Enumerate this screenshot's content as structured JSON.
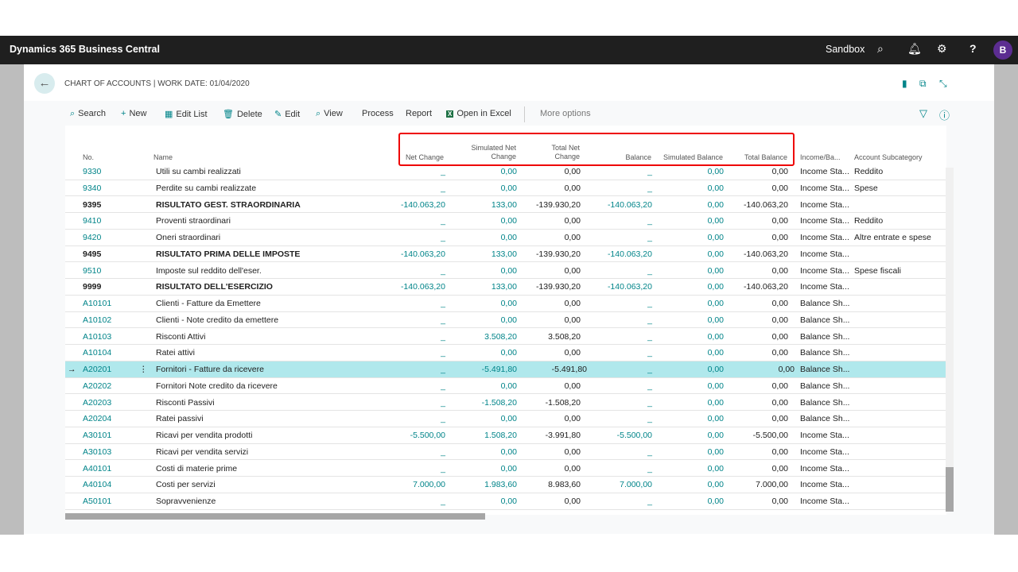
{
  "header": {
    "app_title": "Dynamics 365 Business Central",
    "environment": "Sandbox",
    "avatar_initial": "B",
    "icons": [
      "search-icon",
      "bell-icon",
      "gear-icon",
      "help-icon"
    ]
  },
  "page": {
    "title": "CHART OF ACCOUNTS | WORK DATE: 01/04/2020"
  },
  "actions": [
    {
      "label": "Search",
      "icon": "⌕"
    },
    {
      "label": "New",
      "icon": "+"
    },
    {
      "label": "Edit List",
      "icon": "▦"
    },
    {
      "label": "Delete",
      "icon": "🗑"
    },
    {
      "label": "Edit",
      "icon": "✎"
    },
    {
      "label": "View",
      "icon": "⌕"
    },
    {
      "label": "Process",
      "icon": ""
    },
    {
      "label": "Report",
      "icon": ""
    },
    {
      "label": "Open in Excel",
      "icon": "X"
    },
    {
      "label": "More options",
      "icon": ""
    }
  ],
  "columns": {
    "no": "No.",
    "name": "Name",
    "net_change": "Net Change",
    "sim_net_1": "Simulated Net",
    "sim_net_2": "Change",
    "total_net_1": "Total Net",
    "total_net_2": "Change",
    "balance": "Balance",
    "sim_balance": "Simulated Balance",
    "total_balance": "Total Balance",
    "income_balance": "Income/Ba...",
    "subcategory": "Account Subcategory"
  },
  "rows": [
    {
      "no": "9330",
      "name": "Utili su cambi realizzati",
      "nc": "_",
      "snc": "0,00",
      "tnc": "0,00",
      "bal": "_",
      "sb": "0,00",
      "tb": "0,00",
      "ib": "Income Sta...",
      "sub": "Reddito",
      "bold": false
    },
    {
      "no": "9340",
      "name": "Perdite su cambi realizzate",
      "nc": "_",
      "snc": "0,00",
      "tnc": "0,00",
      "bal": "_",
      "sb": "0,00",
      "tb": "0,00",
      "ib": "Income Sta...",
      "sub": "Spese",
      "bold": false
    },
    {
      "no": "9395",
      "name": "RISULTATO GEST. STRAORDINARIA",
      "nc": "-140.063,20",
      "snc": "133,00",
      "tnc": "-139.930,20",
      "bal": "-140.063,20",
      "sb": "0,00",
      "tb": "-140.063,20",
      "ib": "Income Sta...",
      "sub": "",
      "bold": true
    },
    {
      "no": "9410",
      "name": "Proventi straordinari",
      "nc": "_",
      "snc": "0,00",
      "tnc": "0,00",
      "bal": "_",
      "sb": "0,00",
      "tb": "0,00",
      "ib": "Income Sta...",
      "sub": "Reddito",
      "bold": false
    },
    {
      "no": "9420",
      "name": "Oneri straordinari",
      "nc": "_",
      "snc": "0,00",
      "tnc": "0,00",
      "bal": "_",
      "sb": "0,00",
      "tb": "0,00",
      "ib": "Income Sta...",
      "sub": "Altre entrate e spese",
      "bold": false
    },
    {
      "no": "9495",
      "name": "RISULTATO PRIMA DELLE IMPOSTE",
      "nc": "-140.063,20",
      "snc": "133,00",
      "tnc": "-139.930,20",
      "bal": "-140.063,20",
      "sb": "0,00",
      "tb": "-140.063,20",
      "ib": "Income Sta...",
      "sub": "",
      "bold": true
    },
    {
      "no": "9510",
      "name": "Imposte sul reddito dell'eser.",
      "nc": "_",
      "snc": "0,00",
      "tnc": "0,00",
      "bal": "_",
      "sb": "0,00",
      "tb": "0,00",
      "ib": "Income Sta...",
      "sub": "Spese fiscali",
      "bold": false
    },
    {
      "no": "9999",
      "name": "RISULTATO DELL'ESERCIZIO",
      "nc": "-140.063,20",
      "snc": "133,00",
      "tnc": "-139.930,20",
      "bal": "-140.063,20",
      "sb": "0,00",
      "tb": "-140.063,20",
      "ib": "Income Sta...",
      "sub": "",
      "bold": true
    },
    {
      "no": "A10101",
      "name": "Clienti - Fatture da Emettere",
      "nc": "_",
      "snc": "0,00",
      "tnc": "0,00",
      "bal": "_",
      "sb": "0,00",
      "tb": "0,00",
      "ib": "Balance Sh...",
      "sub": "",
      "bold": false
    },
    {
      "no": "A10102",
      "name": "Clienti - Note credito da emettere",
      "nc": "_",
      "snc": "0,00",
      "tnc": "0,00",
      "bal": "_",
      "sb": "0,00",
      "tb": "0,00",
      "ib": "Balance Sh...",
      "sub": "",
      "bold": false
    },
    {
      "no": "A10103",
      "name": "Risconti Attivi",
      "nc": "_",
      "snc": "3.508,20",
      "tnc": "3.508,20",
      "bal": "_",
      "sb": "0,00",
      "tb": "0,00",
      "ib": "Balance Sh...",
      "sub": "",
      "bold": false
    },
    {
      "no": "A10104",
      "name": "Ratei attivi",
      "nc": "_",
      "snc": "0,00",
      "tnc": "0,00",
      "bal": "_",
      "sb": "0,00",
      "tb": "0,00",
      "ib": "Balance Sh...",
      "sub": "",
      "bold": false
    },
    {
      "no": "A20201",
      "name": "Fornitori - Fatture da ricevere",
      "nc": "_",
      "snc": "-5.491,80",
      "tnc": "-5.491,80",
      "bal": "_",
      "sb": "0,00",
      "tb": "0,00",
      "ib": "Balance Sh...",
      "sub": "",
      "bold": false,
      "selected": true
    },
    {
      "no": "A20202",
      "name": "Fornitori Note credito da ricevere",
      "nc": "_",
      "snc": "0,00",
      "tnc": "0,00",
      "bal": "_",
      "sb": "0,00",
      "tb": "0,00",
      "ib": "Balance Sh...",
      "sub": "",
      "bold": false
    },
    {
      "no": "A20203",
      "name": "Risconti Passivi",
      "nc": "_",
      "snc": "-1.508,20",
      "tnc": "-1.508,20",
      "bal": "_",
      "sb": "0,00",
      "tb": "0,00",
      "ib": "Balance Sh...",
      "sub": "",
      "bold": false
    },
    {
      "no": "A20204",
      "name": "Ratei passivi",
      "nc": "_",
      "snc": "0,00",
      "tnc": "0,00",
      "bal": "_",
      "sb": "0,00",
      "tb": "0,00",
      "ib": "Balance Sh...",
      "sub": "",
      "bold": false
    },
    {
      "no": "A30101",
      "name": "Ricavi per vendita prodotti",
      "nc": "-5.500,00",
      "snc": "1.508,20",
      "tnc": "-3.991,80",
      "bal": "-5.500,00",
      "sb": "0,00",
      "tb": "-5.500,00",
      "ib": "Income Sta...",
      "sub": "",
      "bold": false
    },
    {
      "no": "A30103",
      "name": "Ricavi per vendita servizi",
      "nc": "_",
      "snc": "0,00",
      "tnc": "0,00",
      "bal": "_",
      "sb": "0,00",
      "tb": "0,00",
      "ib": "Income Sta...",
      "sub": "",
      "bold": false
    },
    {
      "no": "A40101",
      "name": "Costi di materie prime",
      "nc": "_",
      "snc": "0,00",
      "tnc": "0,00",
      "bal": "_",
      "sb": "0,00",
      "tb": "0,00",
      "ib": "Income Sta...",
      "sub": "",
      "bold": false
    },
    {
      "no": "A40104",
      "name": "Costi per servizi",
      "nc": "7.000,00",
      "snc": "1.983,60",
      "tnc": "8.983,60",
      "bal": "7.000,00",
      "sb": "0,00",
      "tb": "7.000,00",
      "ib": "Income Sta...",
      "sub": "",
      "bold": false
    },
    {
      "no": "A50101",
      "name": "Sopravvenienze",
      "nc": "_",
      "snc": "0,00",
      "tnc": "0,00",
      "bal": "_",
      "sb": "0,00",
      "tb": "0,00",
      "ib": "Income Sta...",
      "sub": "",
      "bold": false
    }
  ],
  "colors": {
    "accent": "#008489",
    "selected_row": "#b0e8ec",
    "highlight_box": "#e00000",
    "header_bg": "#1f1f1f",
    "avatar": "#5c2d91"
  }
}
